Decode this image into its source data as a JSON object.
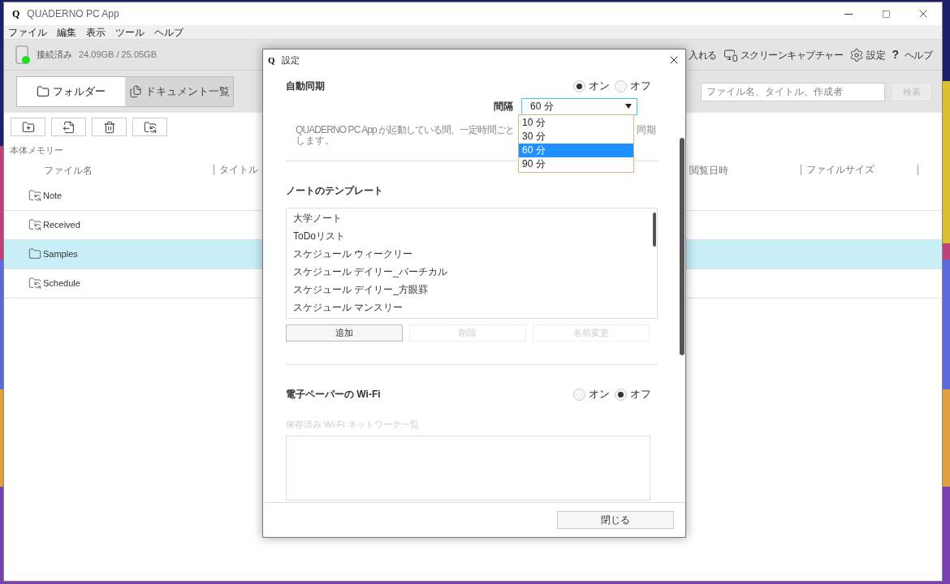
{
  "window": {
    "logo": "Q",
    "title": "QUADERNO PC App"
  },
  "menu": [
    "ファイル",
    "編集",
    "表示",
    "ツール",
    "ヘルプ"
  ],
  "device": {
    "connected": true,
    "status": "接続済み",
    "storage": "24.09GB / 25.05GB"
  },
  "toolbar": [
    {
      "kind": "text",
      "label": "入れる"
    },
    {
      "kind": "capture",
      "label": "スクリーンキャプチャー"
    },
    {
      "kind": "settings",
      "label": "設定"
    },
    {
      "kind": "help",
      "glyph": "?",
      "label": "ヘルプ"
    }
  ],
  "view_tabs": [
    {
      "kind": "folder",
      "label": "フォルダー",
      "selected": true
    },
    {
      "kind": "documents",
      "label": "ドキュメント一覧",
      "selected": false
    }
  ],
  "search": {
    "placeholder": "ファイル名、タイトル、作成者",
    "button": {
      "label": "検索",
      "disabled": true
    }
  },
  "storage_label": "本体メモリー",
  "table": {
    "columns": [
      "ファイル名",
      "タイトル",
      "閲覧日時",
      "ファイルサイズ"
    ],
    "rows": [
      {
        "name": "Note",
        "synced": true,
        "selected": false
      },
      {
        "name": "Received",
        "synced": true,
        "selected": false
      },
      {
        "name": "Samples",
        "synced": false,
        "selected": true
      },
      {
        "name": "Schedule",
        "synced": true,
        "selected": false
      }
    ]
  },
  "dialog": {
    "logo": "Q",
    "title": "設定",
    "auto_sync": {
      "label": "自動同期",
      "options": [
        {
          "label": "オン",
          "selected": true
        },
        {
          "label": "オフ",
          "selected": false
        }
      ],
      "interval": {
        "label": "間隔",
        "value": "60 分",
        "expanded": true,
        "options": [
          {
            "label": "10 分",
            "selected": false
          },
          {
            "label": "30 分",
            "selected": false
          },
          {
            "label": "60 分",
            "selected": true
          },
          {
            "label": "90 分",
            "selected": false
          }
        ]
      },
      "description": {
        "line1_start": "QUADERNO PC App が起動している間、一定時間ごと",
        "line1_end": "同期",
        "line2": "します。"
      }
    },
    "templates": {
      "label": "ノートのテンプレート",
      "items": [
        "大学ノート",
        "ToDoリスト",
        "スケジュール ウィークリー",
        "スケジュール デイリー_バーチカル",
        "スケジュール デイリー_方眼罫",
        "スケジュール マンスリー"
      ],
      "buttons": [
        {
          "label": "追加",
          "disabled": false
        },
        {
          "label": "削除",
          "disabled": true
        },
        {
          "label": "名前変更",
          "disabled": true
        }
      ]
    },
    "wifi": {
      "label": "電子ペーパーの Wi-Fi",
      "options": [
        {
          "label": "オン",
          "selected": false
        },
        {
          "label": "オフ",
          "selected": true
        }
      ],
      "saved_label": "保存済み Wi-Fi ネットワーク一覧",
      "saved_disabled": true
    },
    "close_button": "閉じる"
  }
}
